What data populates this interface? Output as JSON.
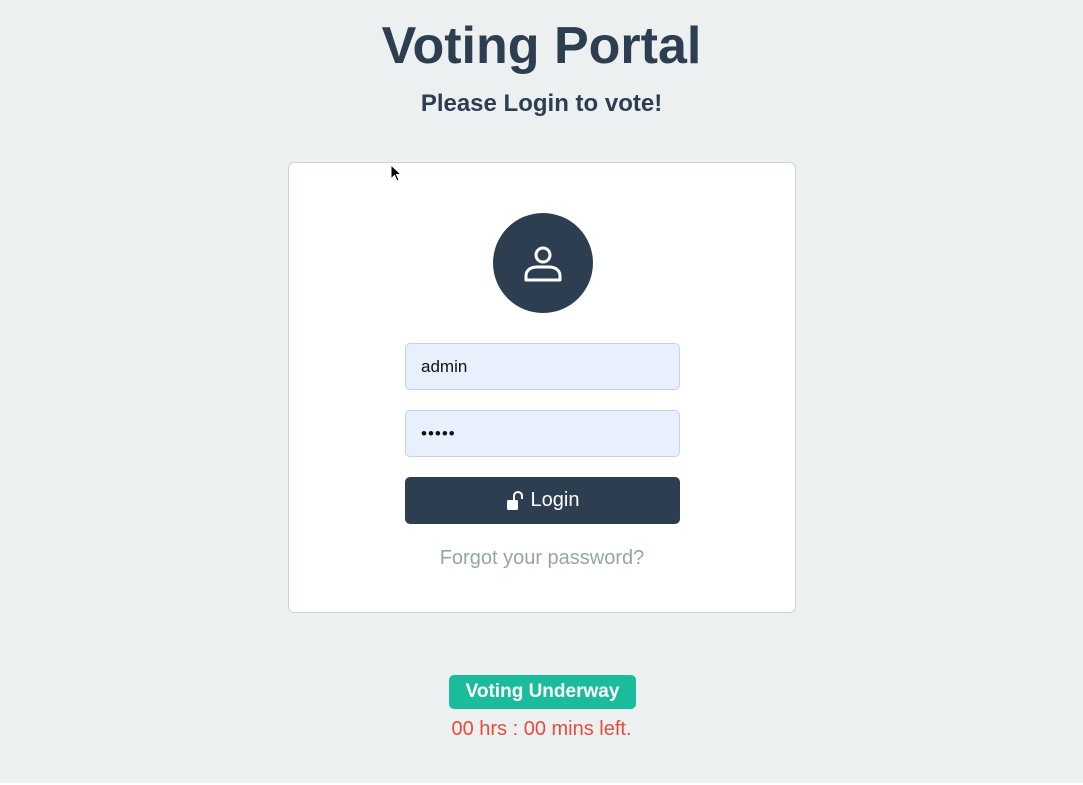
{
  "header": {
    "title": "Voting Portal",
    "subtitle": "Please Login to vote!"
  },
  "login_form": {
    "avatar_icon": "user-icon",
    "username_value": "admin",
    "password_value": "admin",
    "login_icon": "unlock-icon",
    "login_label": "Login",
    "forgot_link": "Forgot your password?"
  },
  "status": {
    "badge_label": "Voting Underway",
    "time_left": "00 hrs : 00 mins left."
  },
  "colors": {
    "primary": "#2c3e50",
    "background": "#ecf0f1",
    "badge": "#1abc9c",
    "timer": "#e74c3c",
    "muted": "#95a5a6",
    "input_bg": "#e8f0fe"
  }
}
